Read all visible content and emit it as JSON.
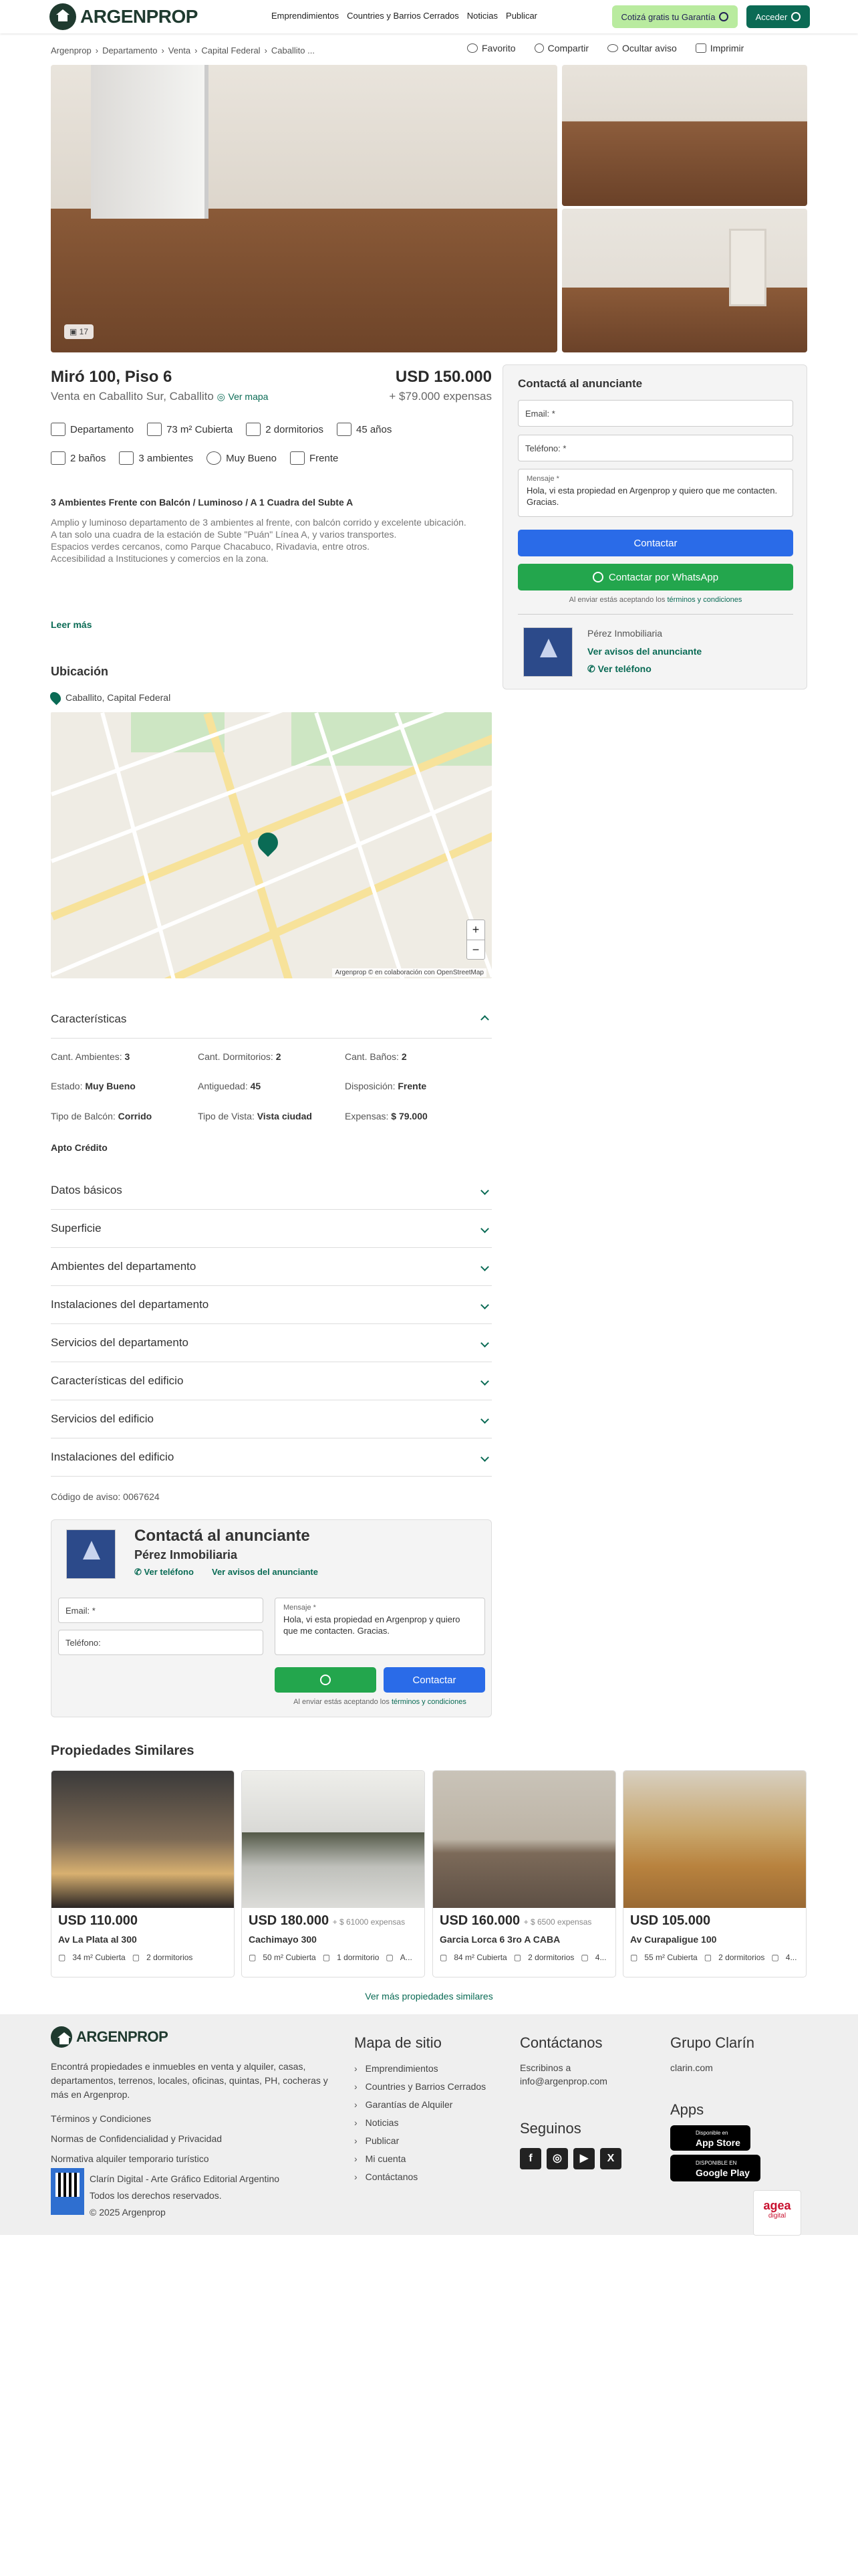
{
  "header": {
    "logo": "ARGENPROP",
    "nav": [
      "Emprendimientos",
      "Countries y Barrios Cerrados",
      "Noticias",
      "Publicar"
    ],
    "garantia_button": "Cotizá gratis tu Garantía",
    "acceder_button": "Acceder"
  },
  "breadcrumbs": [
    "Argenprop",
    "Departamento",
    "Venta",
    "Capital Federal",
    "Caballito ..."
  ],
  "actions": [
    "Favorito",
    "Compartir",
    "Ocultar aviso",
    "Imprimir"
  ],
  "gallery": {
    "photo_count": "17"
  },
  "property": {
    "title": "Miró 100, Piso 6",
    "price": "USD 150.000",
    "location": "Venta en Caballito Sur, Caballito",
    "map_link": "Ver mapa",
    "expenses": "+ $79.000 expensas",
    "features_row1": [
      "Departamento",
      "73 m² Cubierta",
      "2 dormitorios",
      "45 años"
    ],
    "features_row2": [
      "2 baños",
      "3 ambientes",
      "Muy Bueno",
      "Frente"
    ],
    "desc_title": "3 Ambientes Frente con Balcón / Luminoso / A 1 Cuadra del Subte A",
    "description": [
      "Amplio y luminoso departamento de 3 ambientes al frente, con balcón corrido y excelente ubicación.",
      "A tan solo una cuadra de la estación de Subte \"Puán\" Línea A, y varios transportes.",
      "Espacios verdes cercanos, como Parque Chacabuco, Rivadavia, entre otros.",
      "Accesibilidad a Instituciones y comercios en la zona."
    ],
    "leer_mas": "Leer más"
  },
  "contact": {
    "title": "Contactá al anunciante",
    "email_placeholder": "Email: *",
    "phone_placeholder": "Teléfono: *",
    "message_label": "Mensaje *",
    "message": "Hola, vi esta propiedad en Argenprop y quiero que me contacten. Gracias.",
    "contact_button": "Contactar",
    "whatsapp_button": "Contactar por WhatsApp",
    "legal_prefix": "Al enviar estás aceptando los",
    "legal_link": "términos y condiciones",
    "agent": "Pérez Inmobiliaria",
    "ver_avisos": "Ver avisos del anunciante",
    "ver_telefono": "Ver teléfono"
  },
  "ubicacion": {
    "title": "Ubicación",
    "place": "Caballito, Capital Federal",
    "map_attribution": "Argenprop © en colaboración con OpenStreetMap"
  },
  "caracteristicas": {
    "title": "Características",
    "items": [
      {
        "k": "Cant. Ambientes:",
        "v": "3"
      },
      {
        "k": "Cant. Dormitorios:",
        "v": "2"
      },
      {
        "k": "Cant. Baños:",
        "v": "2"
      },
      {
        "k": "Estado:",
        "v": "Muy Bueno"
      },
      {
        "k": "Antiguedad:",
        "v": "45"
      },
      {
        "k": "Disposición:",
        "v": "Frente"
      },
      {
        "k": "Tipo de Balcón:",
        "v": "Corrido"
      },
      {
        "k": "Tipo de Vista:",
        "v": "Vista ciudad"
      },
      {
        "k": "Expensas:",
        "v": "$ 79.000"
      }
    ],
    "extra": "Apto Crédito"
  },
  "sections": [
    "Datos básicos",
    "Superficie",
    "Ambientes del departamento",
    "Instalaciones del departamento",
    "Servicios del departamento",
    "Características del edificio",
    "Servicios del edificio",
    "Instalaciones del edificio"
  ],
  "codigo": "Código de aviso: 0067624",
  "contact2": {
    "title": "Contactá al anunciante",
    "agent": "Pérez Inmobiliaria",
    "ver_telefono": "Ver teléfono",
    "ver_avisos": "Ver avisos del anunciante",
    "email_placeholder": "Email: *",
    "phone_placeholder": "Teléfono:",
    "message_label": "Mensaje *",
    "message": "Hola, vi esta propiedad en Argenprop y quiero que me contacten. Gracias.",
    "contact_button": "Contactar",
    "legal_prefix": "Al enviar estás aceptando los",
    "legal_link": "términos y condiciones"
  },
  "similares": {
    "title": "Propiedades Similares",
    "cards": [
      {
        "price": "USD 110.000",
        "exp": "",
        "addr": "Av La Plata al 300",
        "m2": "34 m² Cubierta",
        "dorm": "2 dormitorios",
        "extra": ""
      },
      {
        "price": "USD 180.000",
        "exp": "+ $ 61000 expensas",
        "addr": "Cachimayo 300",
        "m2": "50 m² Cubierta",
        "dorm": "1 dormitorio",
        "extra": "A..."
      },
      {
        "price": "USD 160.000",
        "exp": "+ $ 6500 expensas",
        "addr": "Garcia Lorca 6 3ro A CABA",
        "m2": "84 m² Cubierta",
        "dorm": "2 dormitorios",
        "extra": "4..."
      },
      {
        "price": "USD 105.000",
        "exp": "",
        "addr": "Av Curapaligue 100",
        "m2": "55 m² Cubierta",
        "dorm": "2 dormitorios",
        "extra": "4..."
      }
    ],
    "ver_mas": "Ver más propiedades similares"
  },
  "footer": {
    "logo": "ARGENPROP",
    "description": "Encontrá propiedades e inmuebles en venta y alquiler, casas, departamentos, terrenos, locales, oficinas, quintas, PH, cocheras y más en Argenprop.",
    "links": [
      "Términos y Condiciones",
      "Normas de Confidencialidad y Privacidad",
      "Normativa alquiler temporario turístico"
    ],
    "company": "Clarín Digital - Arte Gráfico Editorial Argentino",
    "rights": "Todos los derechos reservados.",
    "copyright": "© 2025 Argenprop",
    "mapa_title": "Mapa de sitio",
    "mapa_links": [
      "Emprendimientos",
      "Countries y Barrios Cerrados",
      "Garantías de Alquiler",
      "Noticias",
      "Publicar",
      "Mi cuenta",
      "Contáctanos"
    ],
    "contact_title": "Contáctanos",
    "contact_text": "Escribinos a",
    "contact_email": "info@argenprop.com",
    "seguinos": "Seguinos",
    "grupo_title": "Grupo Clarín",
    "grupo_link": "clarin.com",
    "apps_title": "Apps",
    "appstore_small": "Disponible en",
    "appstore": "App Store",
    "googleplay_small": "DISPONIBLE EN",
    "googleplay": "Google Play",
    "agea": "agea",
    "agea_sub": "digital"
  }
}
